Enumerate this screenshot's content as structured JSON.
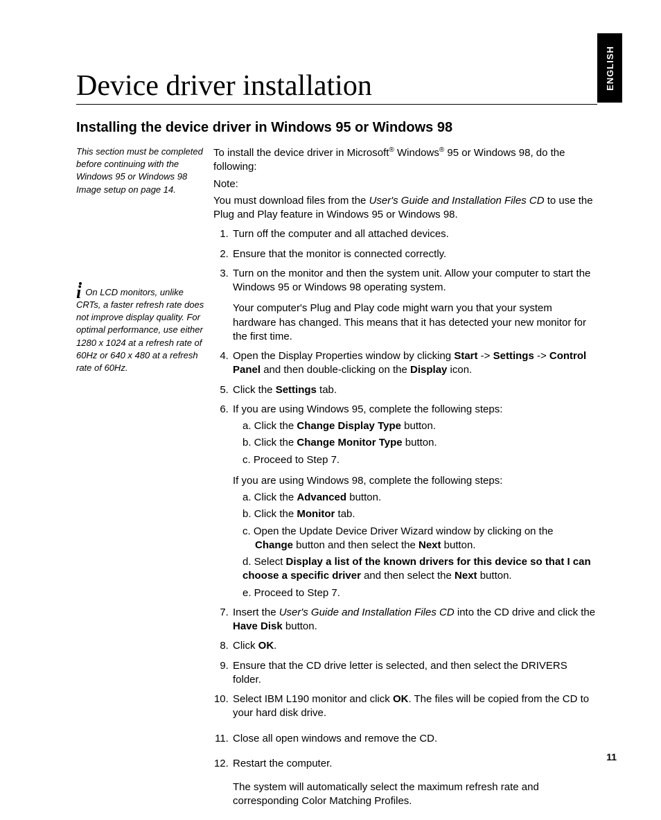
{
  "langTab": "ENGLISH",
  "title": "Device driver installation",
  "section": "Installing the device driver in Windows 95 or Windows 98",
  "sideNote": "This section must be completed before continuing with the Windows 95 or Windows 98 Image setup on page 14.",
  "sideTip": "On LCD monitors, unlike CRTs, a faster refresh rate does not improve display quality. For optimal performance, use either 1280 x 1024 at a refresh rate of 60Hz or 640 x 480 at a refresh rate of 60Hz.",
  "intro": {
    "p1a": "To install the device driver in Microsoft",
    "p1b": " Windows",
    "p1c": " 95 or Windows 98, do the following:",
    "noteLabel": "Note:",
    "note1": "You must download files from the ",
    "cdName": "User's Guide and Installation Files CD",
    "note2": " to use the Plug and Play feature in Windows 95 or Windows 98."
  },
  "steps": {
    "s1": "Turn off the computer and all attached devices.",
    "s2": "Ensure that the monitor is connected correctly.",
    "s3": "Turn on the monitor and then the system unit. Allow your computer to start the Windows 95 or Windows 98 operating system.",
    "s3b": "Your computer's Plug and Play code might warn you that your system hardware has changed. This means that it has detected your new monitor for the first time.",
    "s4a": "Open the Display Properties window by clicking ",
    "s4_start": "Start",
    "s4_arrow1": " -> ",
    "s4_settings": "Settings",
    "s4_arrow2": " -> ",
    "s4_cp": "Control Panel",
    "s4b": " and then double-clicking on the ",
    "s4_display": "Display",
    "s4c": " icon.",
    "s5a": "Click the ",
    "s5_tab": "Settings",
    "s5b": " tab.",
    "s6": "If you are using Windows 95, complete the following steps:",
    "s6a1": "a. Click the ",
    "s6a_btn": "Change Display Type",
    "s6a2": " button.",
    "s6b1": "b. Click the ",
    "s6b_btn": "Change Monitor Type",
    "s6b2": " button.",
    "s6c": "c. Proceed to Step 7.",
    "s6_98": "If you are using Windows 98, complete the following steps:",
    "s6_98a1": "a. Click the ",
    "s6_98a_btn": "Advanced",
    "s6_98a2": " button.",
    "s6_98b1": "b. Click the ",
    "s6_98b_btn": "Monitor",
    "s6_98b2": " tab.",
    "s6_98c1": "c. Open the Update Device Driver Wizard window by clicking on the ",
    "s6_98c_btn1": "Change",
    "s6_98c2": " button and then select the ",
    "s6_98c_btn2": "Next",
    "s6_98c3": " button.",
    "s6_98d1": "d. Select ",
    "s6_98d_bold": "Display a list of the known drivers for this device so that I can choose a specific driver",
    "s6_98d2": " and then select the ",
    "s6_98d_btn": "Next",
    "s6_98d3": " button.",
    "s6_98e": "e. Proceed to Step 7.",
    "s7a": "Insert the ",
    "s7b": " into the CD drive and click the ",
    "s7_btn": "Have Disk",
    "s7c": " button.",
    "s8a": "Click ",
    "s8_ok": "OK",
    "s8b": ".",
    "s9": "Ensure that the CD drive letter is selected, and then select the DRIVERS folder.",
    "s10a": "Select IBM L190 monitor and click ",
    "s10_ok": "OK",
    "s10b": ". The files will be copied from the CD to your hard disk drive.",
    "s11": "Close all open windows and remove the CD.",
    "s12": "Restart the computer.",
    "s12b": "The system will automatically select the maximum refresh rate and corresponding Color Matching Profiles."
  },
  "pageNum": "11"
}
